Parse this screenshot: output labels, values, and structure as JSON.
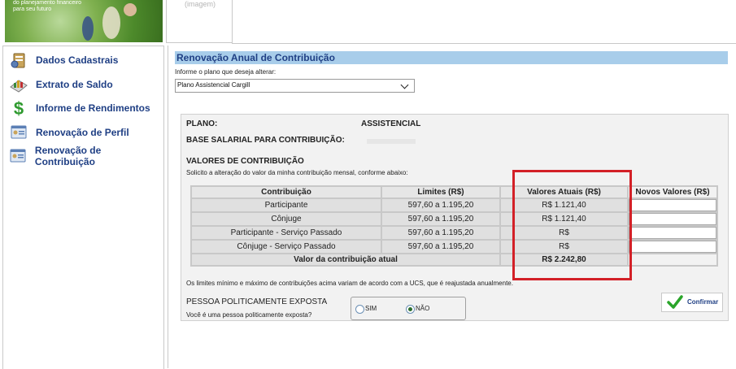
{
  "header": {
    "tagline_line1": "do planejamento financeiro",
    "tagline_line2": "para seu futuro",
    "image_placeholder": "(imagem)"
  },
  "sidebar": {
    "items": [
      {
        "label": "Dados Cadastrais",
        "icon": "registration-icon"
      },
      {
        "label": "Extrato de Saldo",
        "icon": "statement-icon"
      },
      {
        "label": "Informe de Rendimentos",
        "icon": "dollar-icon"
      },
      {
        "label": "Renovação de Perfil",
        "icon": "profile-card-icon"
      },
      {
        "label": "Renovação de Contribuição",
        "icon": "contribution-card-icon"
      }
    ]
  },
  "main": {
    "title": "Renovação Anual de Contribuição",
    "select_label": "Informe o plano que deseja alterar:",
    "select_value": "Plano Assistencial Cargill",
    "plano_label": "PLANO:",
    "plano_value": "ASSISTENCIAL",
    "base_label": "BASE SALARIAL PARA CONTRIBUIÇÃO:",
    "valores_heading": "VALORES DE CONTRIBUIÇÃO",
    "valores_subtitle": "Solicito a alteração do valor da minha contribuição mensal, conforme abaixo:",
    "table": {
      "headers": [
        "Contribuição",
        "Limites (R$)",
        "Valores Atuais (R$)",
        "Novos Valores (R$)"
      ],
      "rows": [
        {
          "contribuicao": "Participante",
          "limites": "597,60 a 1.195,20",
          "atual": "R$ 1.121,40",
          "novo": ""
        },
        {
          "contribuicao": "Cônjuge",
          "limites": "597,60 a 1.195,20",
          "atual": "R$ 1.121,40",
          "novo": ""
        },
        {
          "contribuicao": "Participante - Serviço Passado",
          "limites": "597,60 a 1.195,20",
          "atual": "R$",
          "novo": ""
        },
        {
          "contribuicao": "Cônjuge - Serviço Passado",
          "limites": "597,60 a 1.195,20",
          "atual": "R$",
          "novo": ""
        }
      ],
      "total_label": "Valor da contribuição atual",
      "total_value": "R$ 2.242,80"
    },
    "limits_note": "Os limites mínimo e máximo de contribuições acima variam de acordo com a UCS, que é reajustada anualmente.",
    "pep_heading": "PESSOA POLITICAMENTE EXPOSTA",
    "pep_question": "Você é uma pessoa politicamente exposta?",
    "pep_options": {
      "sim": "SIM",
      "nao": "NÃO",
      "selected": "NÃO"
    },
    "confirm_label": "Confirmar"
  },
  "colors": {
    "accent_blue": "#1f3f84",
    "title_bar": "#a8cdea",
    "highlight_red": "#d32027",
    "confirm_green": "#2aa52a"
  }
}
